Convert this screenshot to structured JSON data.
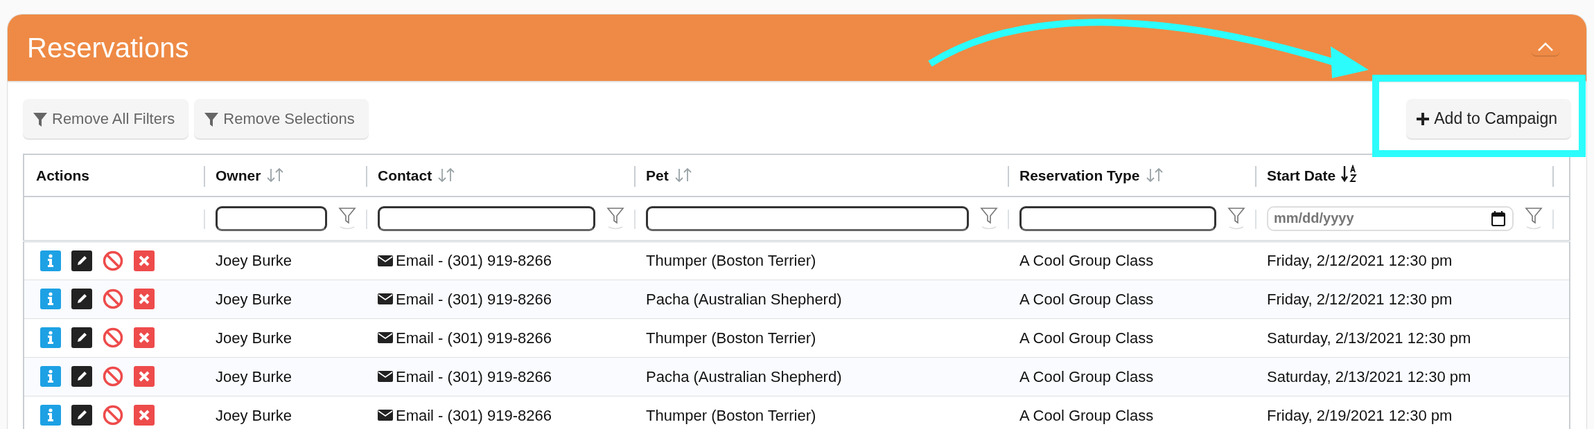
{
  "panel": {
    "title": "Reservations",
    "expanded": true
  },
  "toolbar": {
    "filter_buttons": [
      {
        "label": "Remove All Filters"
      },
      {
        "label": "Remove Selections"
      }
    ],
    "add_button": {
      "label": "Add to Campaign"
    }
  },
  "table": {
    "columns": [
      {
        "label": "Actions"
      },
      {
        "label": "Owner",
        "sorted": false,
        "filter": {
          "kind": "text"
        }
      },
      {
        "label": "Contact",
        "sorted": false,
        "filter": {
          "kind": "text"
        }
      },
      {
        "label": "Pet",
        "sorted": false,
        "filter": {
          "kind": "text"
        }
      },
      {
        "label": "Reservation Type",
        "sorted": false,
        "filter": {
          "kind": "text"
        }
      },
      {
        "label": "Start Date",
        "sorted": true,
        "filter": {
          "kind": "date",
          "placeholder": "mm/dd/yyyy"
        }
      }
    ],
    "rows": [
      {
        "owner": "Joey Burke",
        "contact": "Email - (301) 919-8266",
        "pet": "Thumper (Boston Terrier)",
        "reservation_type": "A Cool Group Class",
        "start_date": "Friday, 2/12/2021 12:30 pm"
      },
      {
        "owner": "Joey Burke",
        "contact": "Email - (301) 919-8266",
        "pet": "Pacha (Australian Shepherd)",
        "reservation_type": "A Cool Group Class",
        "start_date": "Friday, 2/12/2021 12:30 pm"
      },
      {
        "owner": "Joey Burke",
        "contact": "Email - (301) 919-8266",
        "pet": "Thumper (Boston Terrier)",
        "reservation_type": "A Cool Group Class",
        "start_date": "Saturday, 2/13/2021 12:30 pm"
      },
      {
        "owner": "Joey Burke",
        "contact": "Email - (301) 919-8266",
        "pet": "Pacha (Australian Shepherd)",
        "reservation_type": "A Cool Group Class",
        "start_date": "Saturday, 2/13/2021 12:30 pm"
      },
      {
        "owner": "Joey Burke",
        "contact": "Email - (301) 919-8266",
        "pet": "Thumper (Boston Terrier)",
        "reservation_type": "A Cool Group Class",
        "start_date": "Friday, 2/19/2021 12:30 pm"
      }
    ]
  }
}
